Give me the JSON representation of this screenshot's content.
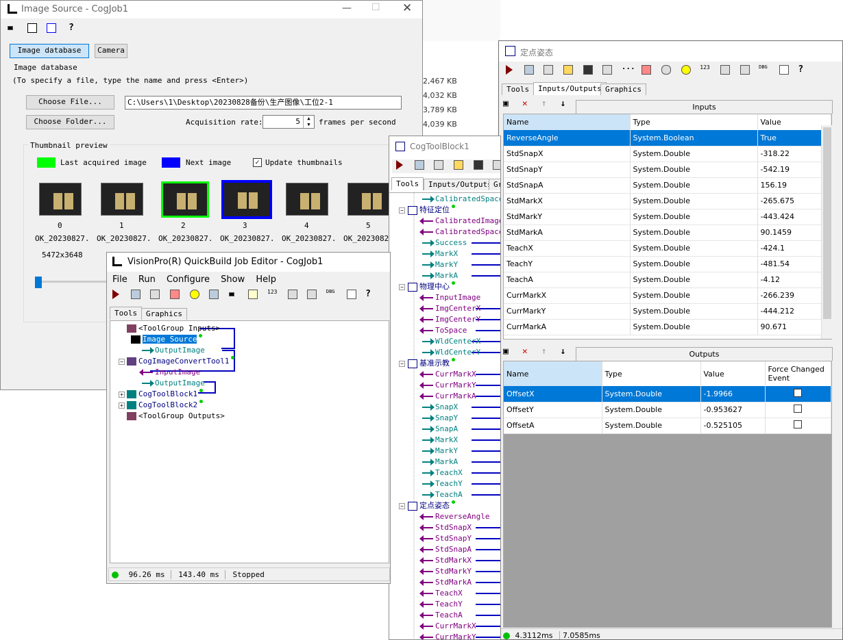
{
  "image_source": {
    "title": "Image Source - CogJob1",
    "tabs": [
      "Image database",
      "Camera"
    ],
    "group_label": "Image database",
    "hint": "(To specify a file, type the name and press <Enter>)",
    "choose_file": "Choose File...",
    "choose_folder": "Choose Folder...",
    "file_path": "C:\\Users\\1\\Desktop\\20230828备份\\生产图像\\工位2-1",
    "acq_label": "Acquisition rate:",
    "acq_value": "5",
    "acq_unit": "frames per second",
    "thumb_title": "Thumbnail preview",
    "legend_last": "Last acquired image",
    "legend_next": "Next image",
    "update_thumbs": "Update thumbnails",
    "thumbs": [
      {
        "idx": "0",
        "name": "OK_20230827."
      },
      {
        "idx": "1",
        "name": "OK_20230827."
      },
      {
        "idx": "2",
        "name": "OK_20230827."
      },
      {
        "idx": "3",
        "name": "OK_20230827."
      },
      {
        "idx": "4",
        "name": "OK_20230827."
      },
      {
        "idx": "5",
        "name": "OK_20230827."
      }
    ],
    "thumb_size": "5472x3648",
    "colors": {
      "last": "#00ff00",
      "next": "#0000ff"
    }
  },
  "bg_sizes": [
    "2,467 KB",
    "4,032 KB",
    "3,789 KB",
    "4,039 KB"
  ],
  "job_editor": {
    "title": "VisionPro(R) QuickBuild Job Editor - CogJob1",
    "menu": [
      "File",
      "Run",
      "Configure",
      "Show",
      "Help"
    ],
    "tabs": [
      "Tools",
      "Graphics"
    ],
    "tree": [
      {
        "t": "<ToolGroup Inputs>",
        "k": "grp"
      },
      {
        "t": "Image Source",
        "k": "sel"
      },
      {
        "t": "OutputImage",
        "k": "out"
      },
      {
        "t": "CogImageConvertTool1",
        "k": "grp"
      },
      {
        "t": "InputImage",
        "k": "in"
      },
      {
        "t": "OutputImage",
        "k": "out"
      },
      {
        "t": "CogToolBlock1",
        "k": "grp"
      },
      {
        "t": "CogToolBlock2",
        "k": "grp"
      },
      {
        "t": "<ToolGroup Outputs>",
        "k": "grp"
      }
    ],
    "status": [
      "96.26 ms",
      "143.40 ms",
      "Stopped"
    ]
  },
  "toolblock": {
    "title": "CogToolBlock1",
    "tabs": [
      "Tools",
      "Inputs/Outputs",
      "Gr"
    ],
    "tree": [
      {
        "t": "CalibratedSpaceN",
        "k": "out",
        "d": 1
      },
      {
        "t": "特征定位",
        "k": "grp",
        "d": 0
      },
      {
        "t": "CalibratedImage",
        "k": "in",
        "d": 1
      },
      {
        "t": "CalibratedSpaceN",
        "k": "in",
        "d": 1
      },
      {
        "t": "Success",
        "k": "out",
        "d": 1
      },
      {
        "t": "MarkX",
        "k": "out",
        "d": 1
      },
      {
        "t": "MarkY",
        "k": "out",
        "d": 1
      },
      {
        "t": "MarkA",
        "k": "out",
        "d": 1
      },
      {
        "t": "物理中心",
        "k": "grp",
        "d": 0
      },
      {
        "t": "InputImage",
        "k": "in",
        "d": 1
      },
      {
        "t": "ImgCenterX",
        "k": "in",
        "d": 1
      },
      {
        "t": "ImgCenterY",
        "k": "in",
        "d": 1
      },
      {
        "t": "ToSpace",
        "k": "in",
        "d": 1
      },
      {
        "t": "WldCenterX",
        "k": "out",
        "d": 1
      },
      {
        "t": "WldCenterY",
        "k": "out",
        "d": 1
      },
      {
        "t": "基准示教",
        "k": "grp",
        "d": 0
      },
      {
        "t": "CurrMarkX",
        "k": "in",
        "d": 1
      },
      {
        "t": "CurrMarkY",
        "k": "in",
        "d": 1
      },
      {
        "t": "CurrMarkA",
        "k": "in",
        "d": 1
      },
      {
        "t": "SnapX",
        "k": "out",
        "d": 1
      },
      {
        "t": "SnapY",
        "k": "out",
        "d": 1
      },
      {
        "t": "SnapA",
        "k": "out",
        "d": 1
      },
      {
        "t": "MarkX",
        "k": "out",
        "d": 1
      },
      {
        "t": "MarkY",
        "k": "out",
        "d": 1
      },
      {
        "t": "MarkA",
        "k": "out",
        "d": 1
      },
      {
        "t": "TeachX",
        "k": "out",
        "d": 1
      },
      {
        "t": "TeachY",
        "k": "out",
        "d": 1
      },
      {
        "t": "TeachA",
        "k": "out",
        "d": 1
      },
      {
        "t": "定点姿态",
        "k": "grp",
        "d": 0
      },
      {
        "t": "ReverseAngle",
        "k": "in",
        "d": 1
      },
      {
        "t": "StdSnapX",
        "k": "in",
        "d": 1
      },
      {
        "t": "StdSnapY",
        "k": "in",
        "d": 1
      },
      {
        "t": "StdSnapA",
        "k": "in",
        "d": 1
      },
      {
        "t": "StdMarkX",
        "k": "in",
        "d": 1
      },
      {
        "t": "StdMarkY",
        "k": "in",
        "d": 1
      },
      {
        "t": "StdMarkA",
        "k": "in",
        "d": 1
      },
      {
        "t": "TeachX",
        "k": "in",
        "d": 1
      },
      {
        "t": "TeachY",
        "k": "in",
        "d": 1
      },
      {
        "t": "TeachA",
        "k": "in",
        "d": 1
      },
      {
        "t": "CurrMarkX",
        "k": "in",
        "d": 1
      },
      {
        "t": "CurrMarkY",
        "k": "in",
        "d": 1
      }
    ]
  },
  "pose": {
    "title": "定点姿态",
    "tabs": [
      "Tools",
      "Inputs/Outputs",
      "Graphics"
    ],
    "inputs_title": "Inputs",
    "outputs_title": "Outputs",
    "in_cols": [
      "Name",
      "Type",
      "Value"
    ],
    "inputs": [
      [
        "ReverseAngle",
        "System.Boolean",
        "True"
      ],
      [
        "StdSnapX",
        "System.Double",
        "-318.22"
      ],
      [
        "StdSnapY",
        "System.Double",
        "-542.19"
      ],
      [
        "StdSnapA",
        "System.Double",
        "156.19"
      ],
      [
        "StdMarkX",
        "System.Double",
        "-265.675"
      ],
      [
        "StdMarkY",
        "System.Double",
        "-443.424"
      ],
      [
        "StdMarkA",
        "System.Double",
        "90.1459"
      ],
      [
        "TeachX",
        "System.Double",
        "-424.1"
      ],
      [
        "TeachY",
        "System.Double",
        "-481.54"
      ],
      [
        "TeachA",
        "System.Double",
        "-4.12"
      ],
      [
        "CurrMarkX",
        "System.Double",
        "-266.239"
      ],
      [
        "CurrMarkY",
        "System.Double",
        "-444.212"
      ],
      [
        "CurrMarkA",
        "System.Double",
        "90.671"
      ]
    ],
    "out_cols": [
      "Name",
      "Type",
      "Value",
      "Force Changed Event"
    ],
    "outputs": [
      [
        "OffsetX",
        "System.Double",
        "-1.9966"
      ],
      [
        "OffsetY",
        "System.Double",
        "-0.953627"
      ],
      [
        "OffsetA",
        "System.Double",
        "-0.525105"
      ]
    ],
    "status": [
      "4.3112ms",
      "7.0585ms"
    ]
  }
}
